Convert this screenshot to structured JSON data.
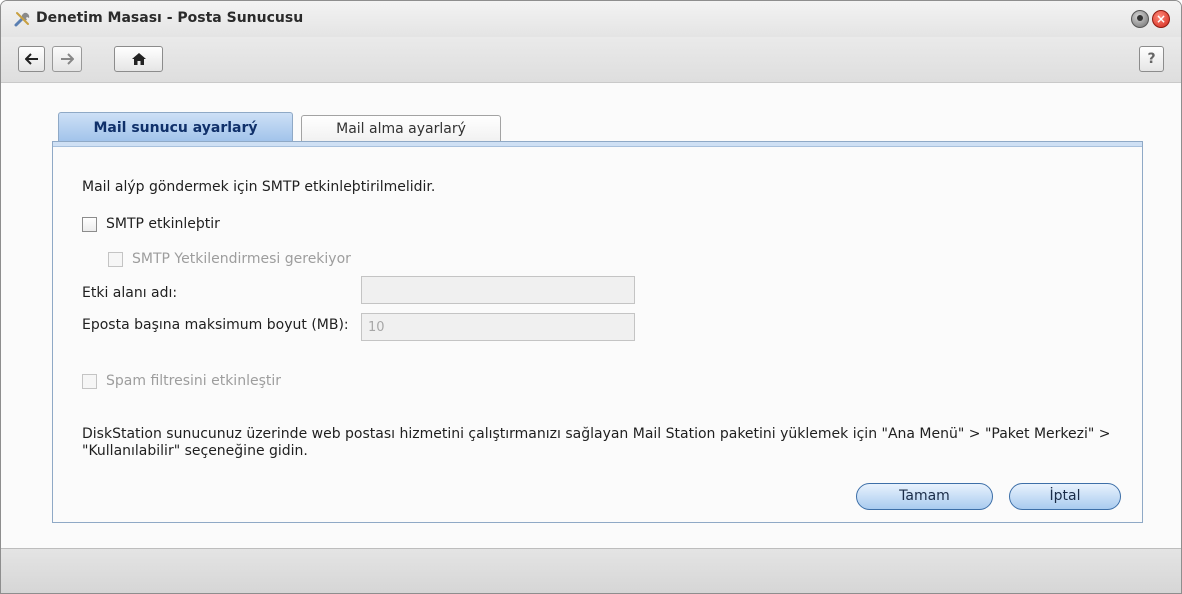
{
  "window": {
    "title": "Denetim Masası - Posta Sunucusu",
    "app_icon": "tools-icon"
  },
  "toolbar": {
    "back_icon": "arrow-left-icon",
    "forward_icon": "arrow-right-icon",
    "home_icon": "home-icon",
    "help_label": "?"
  },
  "tabs": [
    {
      "label": "Mail sunucu ayarlarý",
      "active": true
    },
    {
      "label": "Mail alma ayarlarý",
      "active": false
    }
  ],
  "form": {
    "description": "Mail alýp göndermek için SMTP etkinleþtirilmelidir.",
    "smtp_enable_label": "SMTP etkinleþtir",
    "smtp_enable_checked": false,
    "smtp_auth_label": "SMTP Yetkilendirmesi gerekiyor",
    "smtp_auth_checked": false,
    "domain_label": "Etki alanı adı:",
    "domain_value": "",
    "max_size_label": "Eposta başına maksimum boyut (MB):",
    "max_size_value": "10",
    "spam_label": "Spam filtresini etkinleştir",
    "spam_checked": false,
    "info_text": "DiskStation sunucunuz üzerinde web postası hizmetini çalıştırmanızı sağlayan Mail Station paketini yüklemek için \"Ana Menü\" > \"Paket Merkezi\" > \"Kullanılabilir\" seçeneğine gidin."
  },
  "buttons": {
    "ok_label": "Tamam",
    "cancel_label": "İptal"
  },
  "colors": {
    "accent": "#9fc2ea",
    "close": "#d2261a"
  }
}
